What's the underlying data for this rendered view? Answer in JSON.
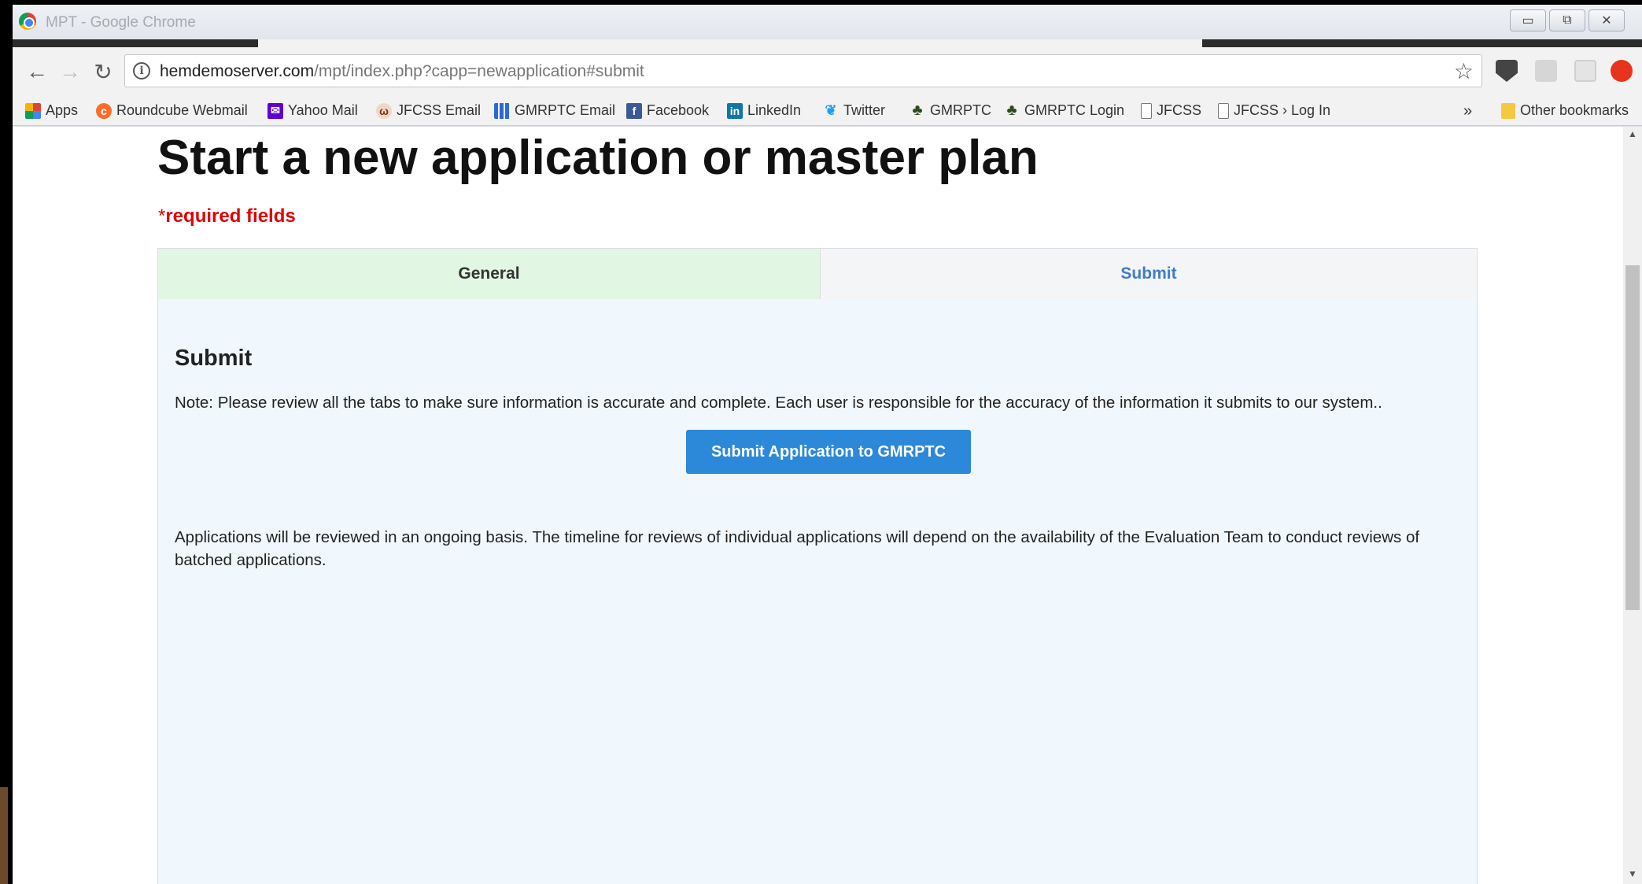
{
  "window": {
    "title": "MPT - Google Chrome",
    "controls": [
      "▭",
      "⧉",
      "✕"
    ]
  },
  "toolbar": {
    "url_host": "hemdemoserver.com",
    "url_path": "/mpt/index.php?capp=newapplication#submit"
  },
  "bookmarks": [
    {
      "label": "Apps",
      "icon": "apps-grid-icon"
    },
    {
      "label": "Roundcube Webmail",
      "icon": "cpanel-icon"
    },
    {
      "label": "Yahoo Mail",
      "icon": "mail-icon"
    },
    {
      "label": "JFCSS Email",
      "icon": "jfcss-icon"
    },
    {
      "label": "GMRPTC Email",
      "icon": "grid-icon"
    },
    {
      "label": "Facebook",
      "icon": "facebook-icon"
    },
    {
      "label": "LinkedIn",
      "icon": "linkedin-icon"
    },
    {
      "label": "Twitter",
      "icon": "twitter-icon"
    },
    {
      "label": "GMRPTC",
      "icon": "tree-icon"
    },
    {
      "label": "GMRPTC Login",
      "icon": "tree-icon"
    },
    {
      "label": "JFCSS",
      "icon": "page-icon"
    },
    {
      "label": "JFCSS › Log In",
      "icon": "page-icon"
    }
  ],
  "bookmarks_overflow": "»",
  "other_bookmarks": "Other bookmarks",
  "page": {
    "title": "Start a new application or master plan",
    "required_asterisk": "*",
    "required_label": "required fields",
    "tabs": {
      "general": "General",
      "submit": "Submit"
    },
    "section_title": "Submit",
    "note": "Note: Please review all the tabs to make sure information is accurate and complete. Each user is responsible for the accuracy of the information it submits to our system..",
    "submit_button": "Submit Application to GMRPTC",
    "review_note": "Applications will be reviewed in an ongoing basis. The timeline for reviews of individual applications will depend on the availability of the Evaluation Team to conduct reviews of batched applications."
  },
  "colors": {
    "accent_button": "#2c88d9",
    "required_red": "#e00000",
    "tab_general_bg": "#e2f7e3",
    "tab_submit_text": "#3f7cc8"
  }
}
